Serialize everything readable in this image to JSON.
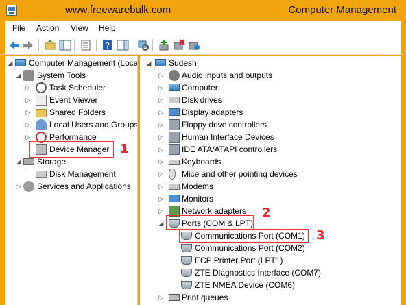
{
  "window": {
    "watermark": "www.freewarebulk.com",
    "title": "Computer Management"
  },
  "menu": {
    "file": "File",
    "action": "Action",
    "view": "View",
    "help": "Help"
  },
  "left_tree": {
    "root": "Computer Management (Local",
    "system_tools": "System Tools",
    "task_scheduler": "Task Scheduler",
    "event_viewer": "Event Viewer",
    "shared_folders": "Shared Folders",
    "local_users": "Local Users and Groups",
    "performance": "Performance",
    "device_manager": "Device Manager",
    "storage": "Storage",
    "disk_management": "Disk Management",
    "services": "Services and Applications"
  },
  "right_tree": {
    "root": "Sudesh",
    "items": [
      "Audio inputs and outputs",
      "Computer",
      "Disk drives",
      "Display adapters",
      "Floppy drive controllers",
      "Human Interface Devices",
      "IDE ATA/ATAPI controllers",
      "Keyboards",
      "Mice and other pointing devices",
      "Modems",
      "Monitors",
      "Network adapters",
      "Ports (COM & LPT)"
    ],
    "ports": [
      "Communications Port (COM1)",
      "Communications Port (COM2)",
      "ECP Printer Port (LPT1)",
      "ZTE Diagnostics Interface (COM7)",
      "ZTE NMEA Device (COM6)"
    ],
    "last": "Print queues"
  },
  "markers": {
    "one": "1",
    "two": "2",
    "three": "3"
  },
  "colors": {
    "title_bar": "#f0a30a",
    "highlight_box": "#e33333",
    "marker": "#e5232a"
  }
}
